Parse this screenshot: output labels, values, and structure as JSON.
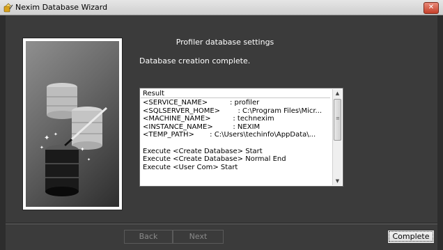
{
  "window": {
    "title": "Nexim Database Wizard",
    "close_label": "✕"
  },
  "main": {
    "heading": "Profiler database settings",
    "status": "Database creation complete.",
    "result": {
      "header": "Result",
      "lines": [
        "<SERVICE_NAME>          : profiler",
        "<SQLSERVER_HOME>        : C:\\Program Files\\Micr...",
        "<MACHINE_NAME>          : technexim",
        "<INSTANCE_NAME>         : NEXIM",
        "<TEMP_PATH>       : C:\\Users\\techinfo\\AppData\\...",
        "",
        "Execute <Create Database> Start",
        "Execute <Create Database> Normal End",
        "Execute <User Com> Start"
      ]
    }
  },
  "footer": {
    "back_label": "Back",
    "next_label": "Next",
    "complete_label": "Complete"
  },
  "colors": {
    "background": "#3b3b3b",
    "close_button": "#c5402a"
  },
  "icons": {
    "app": "wizard-icon",
    "illustration": "database-wizard-illustration"
  }
}
